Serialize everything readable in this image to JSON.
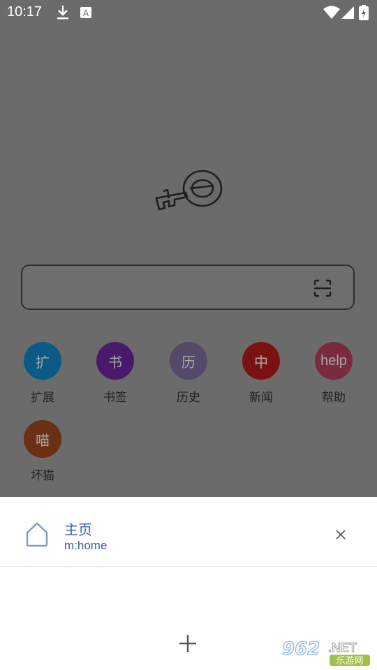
{
  "status_bar": {
    "time": "10:17",
    "icons": [
      "download-icon",
      "a-badge-icon",
      "wifi-icon",
      "signal-icon",
      "battery-charging-icon"
    ]
  },
  "search": {
    "value": "",
    "scan_icon": "scan-icon"
  },
  "shortcuts": [
    {
      "glyph": "扩",
      "label": "扩展",
      "color": "#0b5a85"
    },
    {
      "glyph": "书",
      "label": "书签",
      "color": "#4a1a6a"
    },
    {
      "glyph": "历",
      "label": "历史",
      "color": "#54486b"
    },
    {
      "glyph": "中",
      "label": "新闻",
      "color": "#7a1212"
    },
    {
      "glyph": "help",
      "label": "帮助",
      "color": "#7a2b3f"
    },
    {
      "glyph": "喵",
      "label": "坏猫",
      "color": "#6b2f14"
    }
  ],
  "tab_sheet": {
    "tab": {
      "title": "主页",
      "url": "m:home",
      "icon": "home-icon",
      "close_icon": "close-icon"
    },
    "add_icon": "plus-icon",
    "accent": "#3b5ea8"
  },
  "watermark": {
    "number": "962",
    "suffix": ".NET",
    "caption": "乐游网"
  }
}
